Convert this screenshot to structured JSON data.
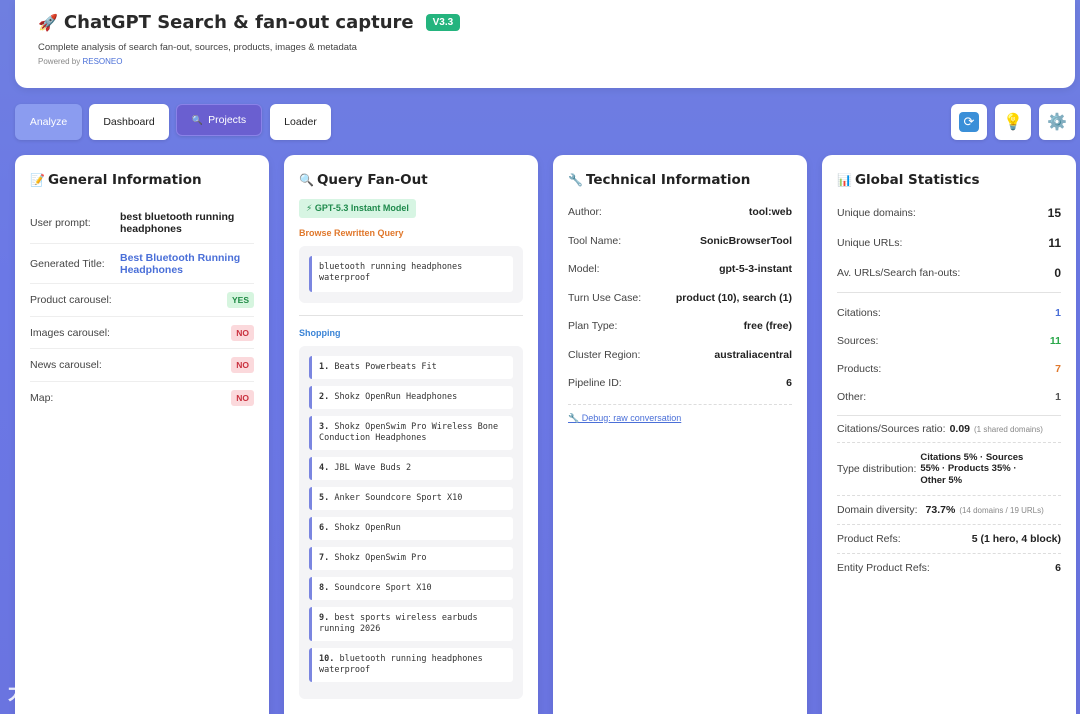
{
  "header": {
    "title": "ChatGPT Search & fan-out capture",
    "version": "V3.3",
    "subtitle": "Complete analysis of search fan-out, sources, products, images & metadata",
    "powered_prefix": "Powered by",
    "powered_brand": "RESONEO"
  },
  "nav": {
    "analyze": "Analyze",
    "dashboard": "Dashboard",
    "projects": "Projects",
    "loader": "Loader"
  },
  "general": {
    "title": "General Information",
    "user_prompt_label": "User prompt:",
    "user_prompt_value": "best bluetooth running headphones",
    "generated_title_label": "Generated Title:",
    "generated_title_value": "Best Bluetooth Running Headphones",
    "product_carousel_label": "Product carousel:",
    "product_carousel_value": "YES",
    "images_carousel_label": "Images carousel:",
    "images_carousel_value": "NO",
    "news_carousel_label": "News carousel:",
    "news_carousel_value": "NO",
    "map_label": "Map:",
    "map_value": "NO"
  },
  "fanout": {
    "title": "Query Fan-Out",
    "model_badge": "⚡ GPT-5.3 Instant Model",
    "browse_label": "Browse Rewritten Query",
    "browse_query": "bluetooth running headphones waterproof",
    "shopping_label": "Shopping",
    "shopping": [
      {
        "num": "1.",
        "text": "Beats Powerbeats Fit"
      },
      {
        "num": "2.",
        "text": "Shokz OpenRun Headphones"
      },
      {
        "num": "3.",
        "text": "Shokz OpenSwim Pro Wireless Bone Conduction Headphones"
      },
      {
        "num": "4.",
        "text": "JBL Wave Buds 2"
      },
      {
        "num": "5.",
        "text": "Anker Soundcore Sport X10"
      },
      {
        "num": "6.",
        "text": "Shokz OpenRun"
      },
      {
        "num": "7.",
        "text": "Shokz OpenSwim Pro"
      },
      {
        "num": "8.",
        "text": "Soundcore Sport X10"
      },
      {
        "num": "9.",
        "text": "best sports wireless earbuds running 2026"
      },
      {
        "num": "10.",
        "text": "bluetooth running headphones waterproof"
      }
    ]
  },
  "technical": {
    "title": "Technical Information",
    "rows": [
      {
        "label": "Author:",
        "value": "tool:web"
      },
      {
        "label": "Tool Name:",
        "value": "SonicBrowserTool"
      },
      {
        "label": "Model:",
        "value": "gpt-5-3-instant"
      },
      {
        "label": "Turn Use Case:",
        "value": "product (10), search (1)"
      },
      {
        "label": "Plan Type:",
        "value": "free (free)"
      },
      {
        "label": "Cluster Region:",
        "value": "australiacentral"
      },
      {
        "label": "Pipeline ID:",
        "value": "6"
      }
    ],
    "debug": "🔧 Debug: raw conversation"
  },
  "stats": {
    "title": "Global Statistics",
    "unique_domains_label": "Unique domains:",
    "unique_domains": "15",
    "unique_urls_label": "Unique URLs:",
    "unique_urls": "11",
    "av_urls_label": "Av. URLs/Search fan-outs:",
    "av_urls": "0",
    "citations_label": "Citations:",
    "citations": "1",
    "sources_label": "Sources:",
    "sources": "11",
    "products_label": "Products:",
    "products": "7",
    "other_label": "Other:",
    "other": "1",
    "ratio_label": "Citations/Sources ratio:",
    "ratio_value": "0.09",
    "ratio_note": "(1 shared domains)",
    "type_dist_label": "Type distribution:",
    "type_dist_value": "Citations 5% · Sources 55% · Products 35% · Other 5%",
    "diversity_label": "Domain diversity:",
    "diversity_value": "73.7%",
    "diversity_note": "(14 domains / 19 URLs)",
    "product_refs_label": "Product Refs:",
    "product_refs_value": "5 (1 hero, 4 block)",
    "entity_refs_label": "Entity Product Refs:",
    "entity_refs_value": "6"
  },
  "colors": {
    "citations": "#4a6fd8",
    "sources": "#2aa84a",
    "products": "#e0782c",
    "other": "#555555"
  },
  "watermark": "大数跨境"
}
